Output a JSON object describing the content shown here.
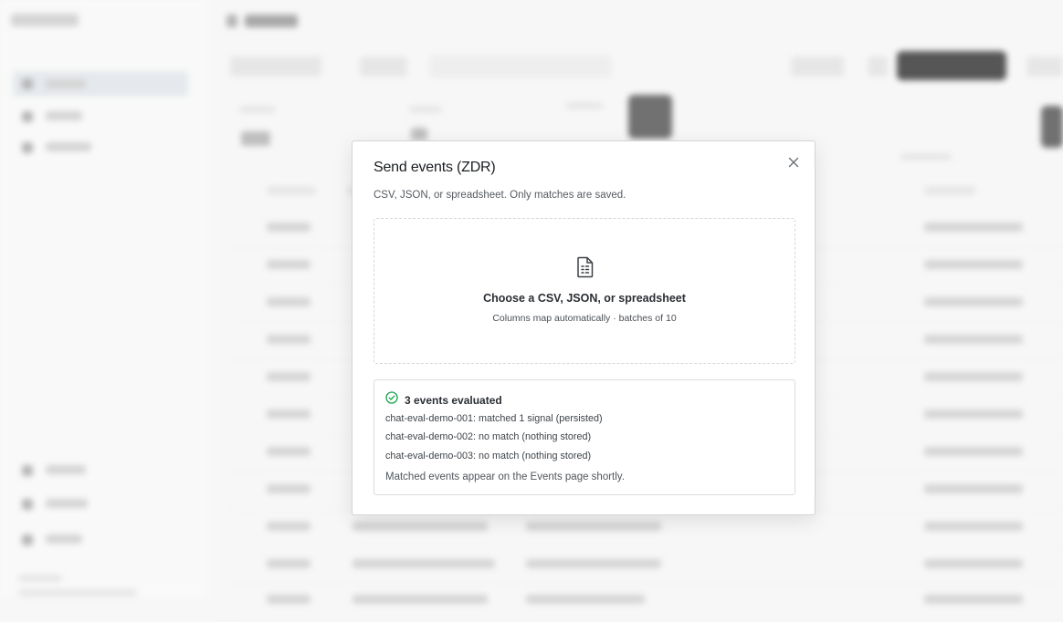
{
  "modal": {
    "title": "Send events (ZDR)",
    "description": "CSV, JSON, or spreadsheet. Only matches are saved.",
    "close_icon": "close-icon",
    "dropzone": {
      "icon": "file-spreadsheet-icon",
      "title": "Choose a CSV, JSON, or spreadsheet",
      "subtitle": "Columns map automatically · batches of 10"
    },
    "result": {
      "icon": "check-circle-icon",
      "status_color": "#16a34a",
      "title": "3 events evaluated",
      "lines": [
        "chat-eval-demo-001: matched 1 signal (persisted)",
        "chat-eval-demo-002: no match (nothing stored)",
        "chat-eval-demo-003: no match (nothing stored)"
      ],
      "footer": "Matched events appear on the Events page shortly."
    }
  }
}
